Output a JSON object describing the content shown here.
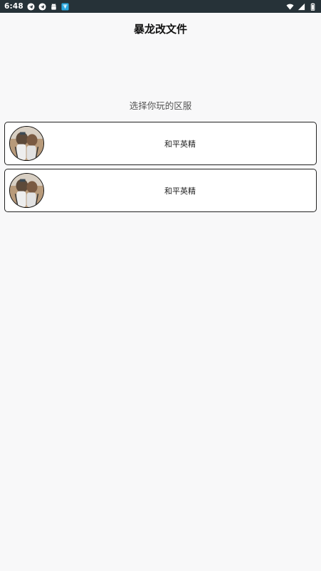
{
  "status_bar": {
    "time": "6:48",
    "notification_icons": [
      "telegram-icon",
      "telegram-icon",
      "android-icon",
      "app-badge-icon"
    ],
    "system_icons": [
      "wifi-icon",
      "signal-icon",
      "battery-icon"
    ]
  },
  "app": {
    "title": "暴龙改文件"
  },
  "main": {
    "section_title": "选择你玩的区服",
    "servers": [
      {
        "name": "和平英精"
      },
      {
        "name": "和平英精"
      }
    ]
  },
  "colors": {
    "status_bar_bg": "#263238",
    "page_bg": "#f8f8f9",
    "card_bg": "#ffffff",
    "card_border": "#222222"
  }
}
